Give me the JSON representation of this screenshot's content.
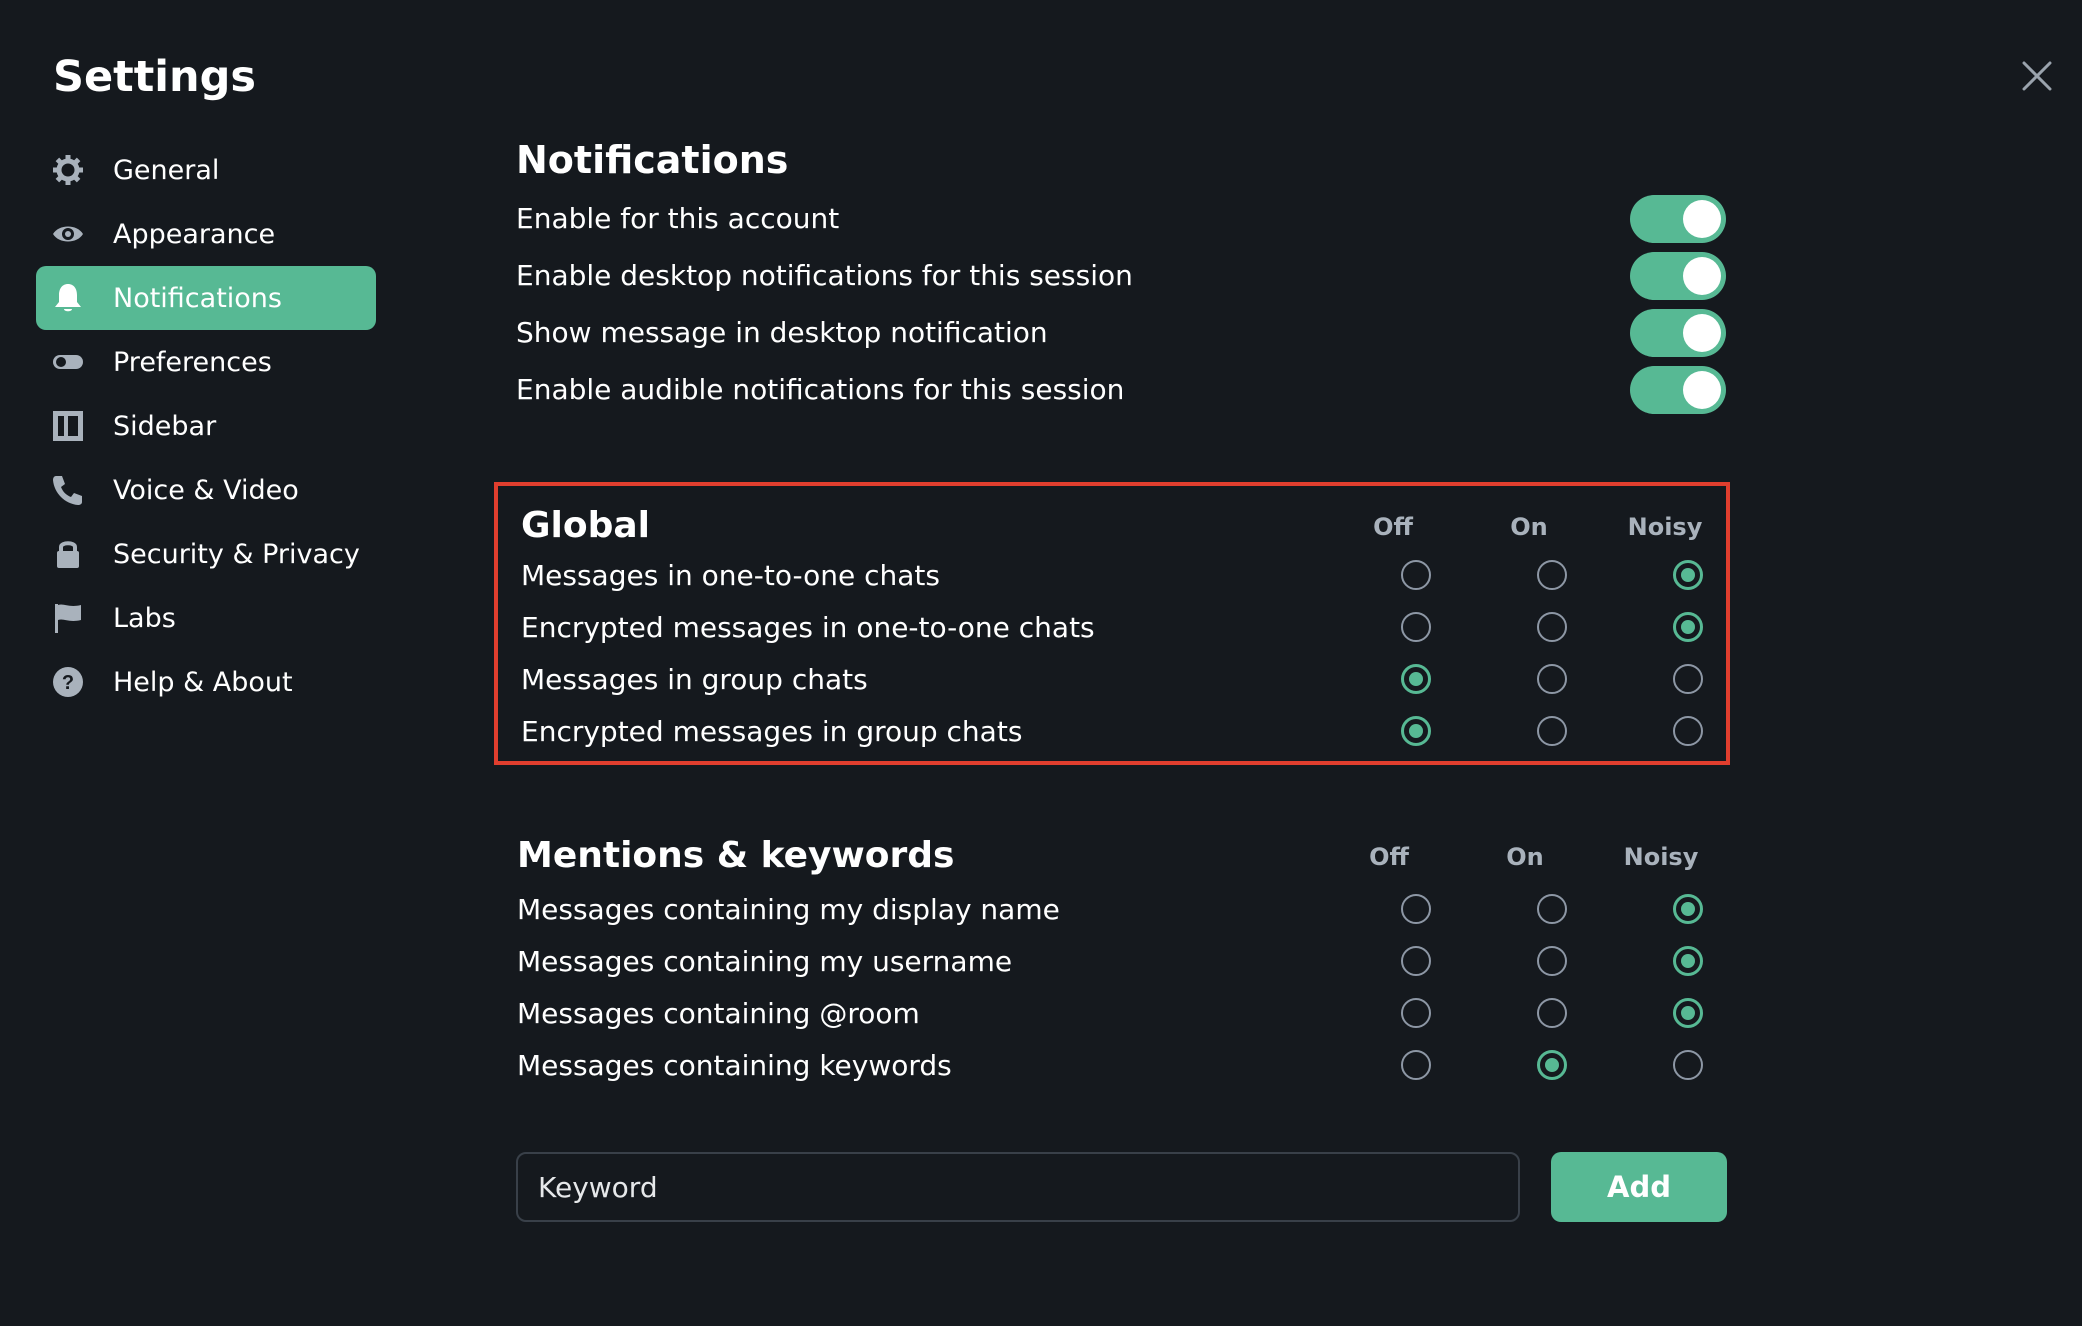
{
  "dialog": {
    "title": "Settings"
  },
  "sidebar": {
    "items": [
      {
        "label": "General",
        "icon": "gear-icon",
        "active": false
      },
      {
        "label": "Appearance",
        "icon": "eye-icon",
        "active": false
      },
      {
        "label": "Notifications",
        "icon": "bell-icon",
        "active": true
      },
      {
        "label": "Preferences",
        "icon": "toggle-icon",
        "active": false
      },
      {
        "label": "Sidebar",
        "icon": "sidebar-layout-icon",
        "active": false
      },
      {
        "label": "Voice & Video",
        "icon": "phone-icon",
        "active": false
      },
      {
        "label": "Security & Privacy",
        "icon": "lock-icon",
        "active": false
      },
      {
        "label": "Labs",
        "icon": "flag-icon",
        "active": false
      },
      {
        "label": "Help & About",
        "icon": "help-icon",
        "active": false
      }
    ]
  },
  "notifications": {
    "heading": "Notifications",
    "toggles": [
      {
        "label": "Enable for this account",
        "on": true
      },
      {
        "label": "Enable desktop notifications for this session",
        "on": true
      },
      {
        "label": "Show message in desktop notification",
        "on": true
      },
      {
        "label": "Enable audible notifications for this session",
        "on": true
      }
    ]
  },
  "columns": [
    "Off",
    "On",
    "Noisy"
  ],
  "global": {
    "heading": "Global",
    "rows": [
      {
        "label": "Messages in one-to-one chats",
        "selected": "Noisy"
      },
      {
        "label": "Encrypted messages in one-to-one chats",
        "selected": "Noisy"
      },
      {
        "label": "Messages in group chats",
        "selected": "Off"
      },
      {
        "label": "Encrypted messages in group chats",
        "selected": "Off"
      }
    ]
  },
  "mentions": {
    "heading": "Mentions & keywords",
    "rows": [
      {
        "label": "Messages containing my display name",
        "selected": "Noisy"
      },
      {
        "label": "Messages containing my username",
        "selected": "Noisy"
      },
      {
        "label": "Messages containing @room",
        "selected": "Noisy"
      },
      {
        "label": "Messages containing keywords",
        "selected": "On"
      }
    ]
  },
  "keyword": {
    "placeholder": "Keyword",
    "value": "",
    "add_label": "Add"
  },
  "colors": {
    "accent": "#57b994",
    "background": "#15191e",
    "highlight_border": "#e03e2e"
  }
}
